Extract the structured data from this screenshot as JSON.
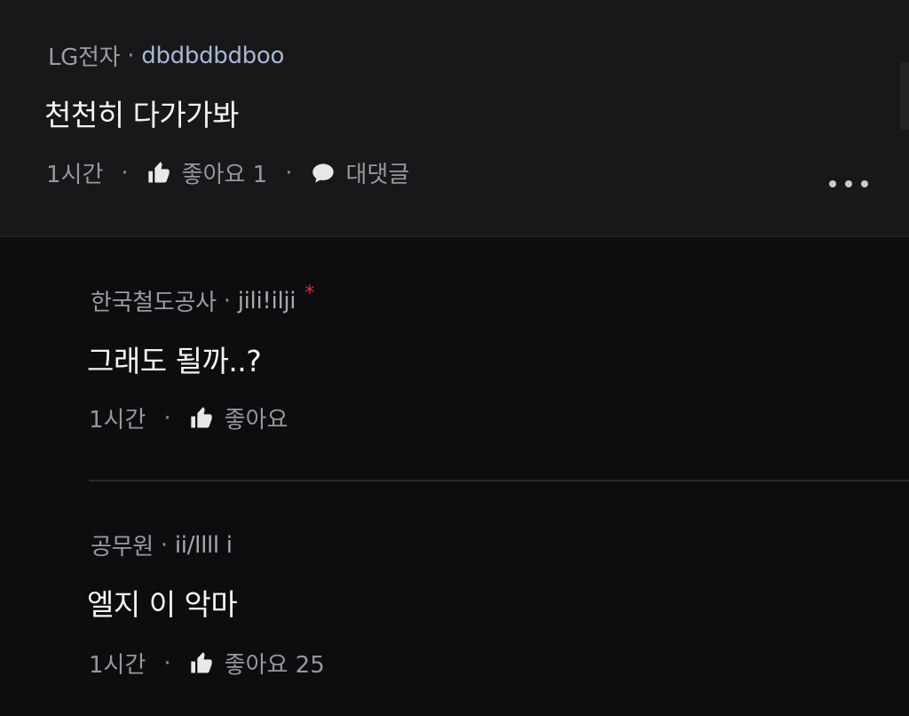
{
  "comments": [
    {
      "company": "LG전자",
      "separator": "·",
      "nickname": "dbdbdbdboo",
      "text": "천천히 다가가봐",
      "time": "1시간",
      "like_label": "좋아요 1",
      "reply_label": "대댓글"
    },
    {
      "company": "한국철도공사",
      "separator": "·",
      "nickname": "jili!ilji",
      "badge": "*",
      "text": "그래도 될까..?",
      "time": "1시간",
      "like_label": "좋아요"
    },
    {
      "company": "공무원",
      "separator": "·",
      "nickname": "ii/llll i",
      "text": "엘지 이 악마",
      "time": "1시간",
      "like_label": "좋아요 25"
    }
  ],
  "action_separator": "·",
  "icons": {
    "like": "thumbs-up-icon",
    "reply": "speech-bubble-icon",
    "more": "more-horizontal-icon"
  },
  "colors": {
    "background": "#0d0d0f",
    "top_comment_background": "#18181a",
    "badge": "#e0313a"
  }
}
